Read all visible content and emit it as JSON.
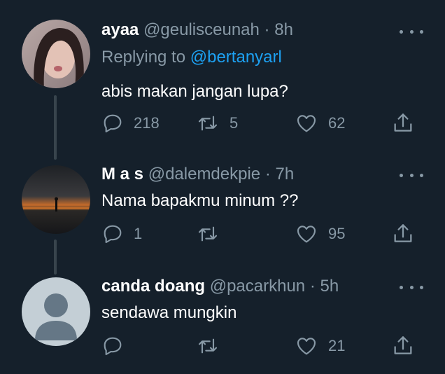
{
  "tweets": [
    {
      "name": "ayaa",
      "handle": "@geulisceunah",
      "separator": "·",
      "time": "8h",
      "replying_prefix": "Replying to",
      "replying_to": "@bertanyarl",
      "text": "abis makan jangan lupa?",
      "reply_count": "218",
      "retweet_count": "5",
      "like_count": "62"
    },
    {
      "name": "M a s",
      "handle": "@dalemdekpie",
      "separator": "·",
      "time": "7h",
      "text": "Nama bapakmu minum ??",
      "reply_count": "1",
      "retweet_count": "",
      "like_count": "95"
    },
    {
      "name": "canda doang",
      "handle": "@pacarkhun",
      "separator": "·",
      "time": "5h",
      "text": "sendawa mungkin",
      "reply_count": "",
      "retweet_count": "",
      "like_count": "21"
    }
  ],
  "icons": {
    "reply": "reply-icon",
    "retweet": "retweet-icon",
    "like": "heart-icon",
    "share": "share-icon",
    "more": "more-icon"
  },
  "colors": {
    "background": "#15202b",
    "text": "#ffffff",
    "secondary": "#8899a6",
    "accent": "#1da1f2",
    "thread_line": "#38444d"
  }
}
